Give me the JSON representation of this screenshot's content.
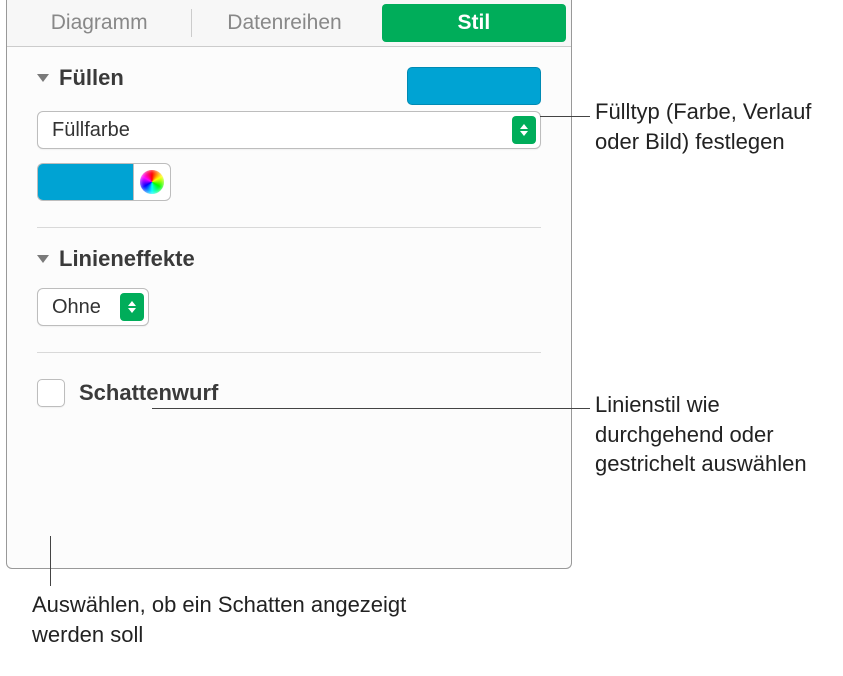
{
  "tabs": {
    "diagram": "Diagramm",
    "series": "Datenreihen",
    "style": "Stil"
  },
  "fill": {
    "title": "Füllen",
    "dropdown": "Füllfarbe",
    "swatch_color": "#00a3d3"
  },
  "line_effects": {
    "title": "Linieneffekte",
    "dropdown": "Ohne"
  },
  "shadow": {
    "title": "Schattenwurf"
  },
  "annotations": {
    "fill": "Fülltyp (Farbe, Verlauf oder Bild) festlegen",
    "line": "Linienstil wie durchgehend oder gestrichelt auswählen",
    "shadow": "Auswählen, ob ein Schatten angezeigt werden soll"
  },
  "colors": {
    "accent_green": "#00ad5a",
    "accent_cyan": "#00a3d3"
  }
}
